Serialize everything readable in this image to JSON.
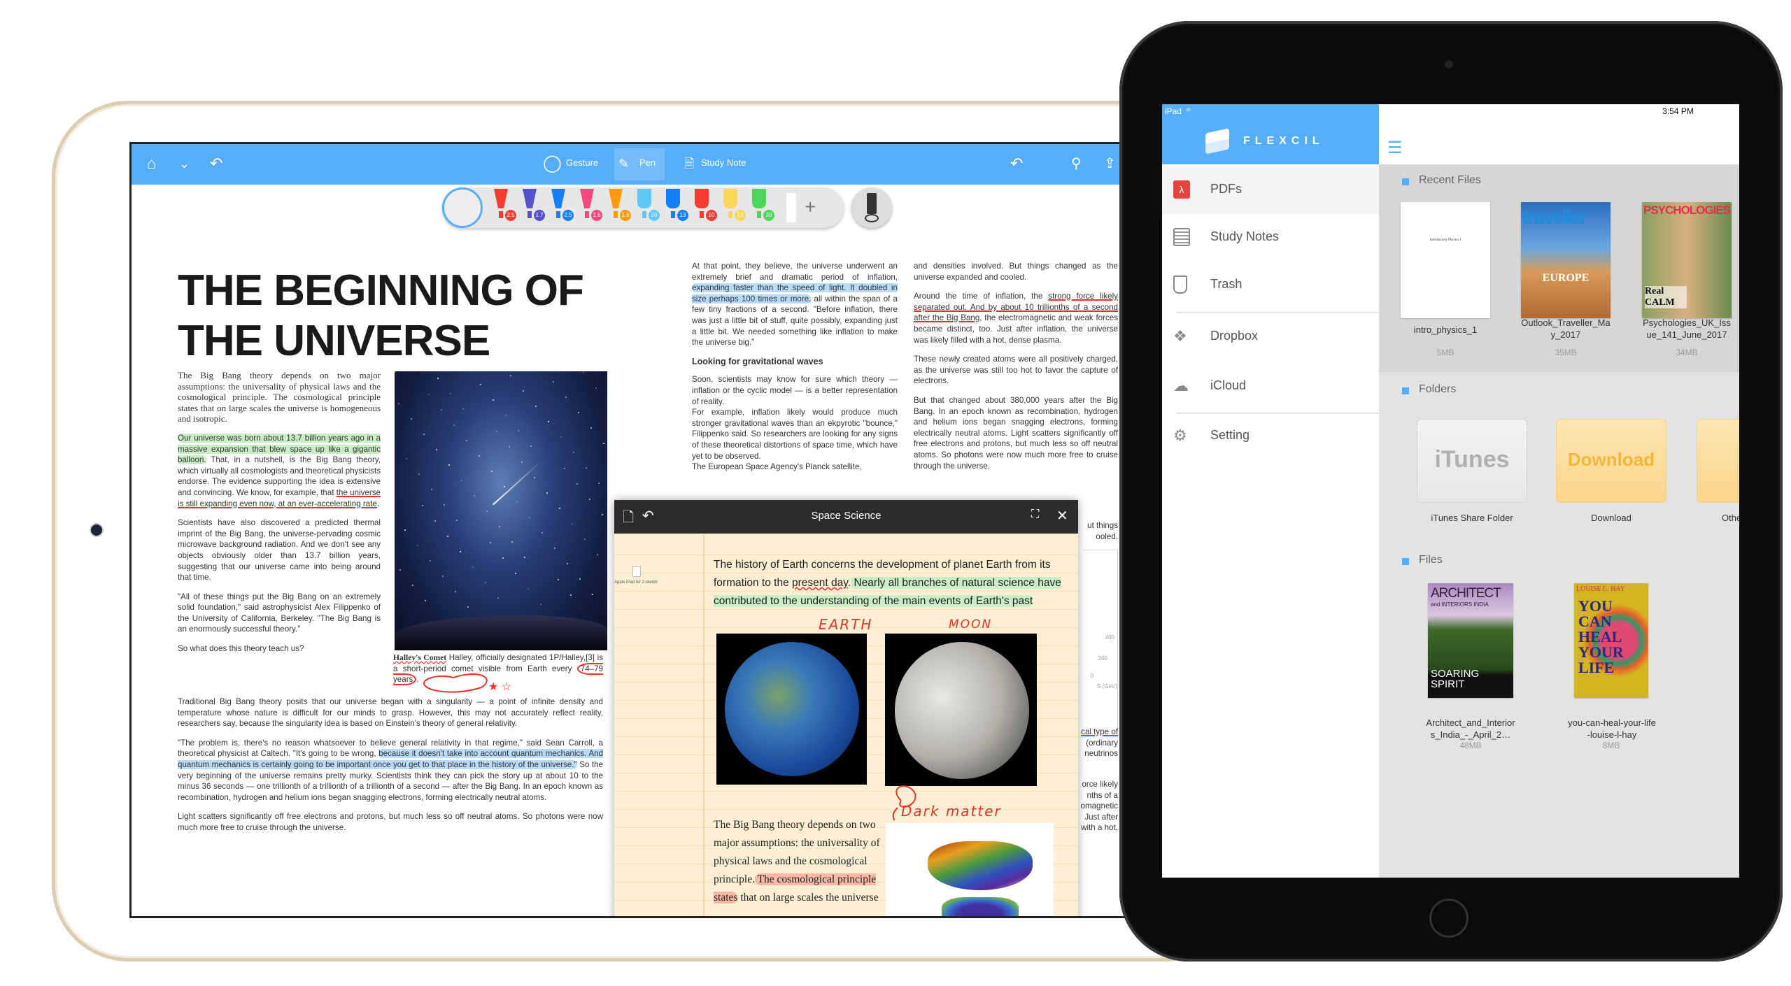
{
  "reader": {
    "toolbar": {
      "gesture": "Gesture",
      "pen": "Pen",
      "study_note": "Study Note",
      "accent": "#55aef7",
      "icons": [
        "home-icon",
        "chevron-down-icon",
        "undo-icon",
        "gesture-icon",
        "pen-icon",
        "study-note-icon",
        "redo-icon",
        "search-icon",
        "share-icon"
      ]
    },
    "pens": [
      {
        "color": "#f63b30",
        "size": "2.5",
        "type": "pen"
      },
      {
        "color": "#5552cc",
        "size": "1.7",
        "type": "pen"
      },
      {
        "color": "#1580f6",
        "size": "2.5",
        "type": "pen"
      },
      {
        "color": "#f5487c",
        "size": "1.6",
        "type": "pen"
      },
      {
        "color": "#fb9a10",
        "size": "1.6",
        "type": "pen"
      },
      {
        "color": "#5ec8f6",
        "size": "20",
        "type": "highlighter"
      },
      {
        "color": "#1580f6",
        "size": "13",
        "type": "highlighter"
      },
      {
        "color": "#f63b30",
        "size": "10",
        "type": "highlighter"
      },
      {
        "color": "#fbd75a",
        "size": "13",
        "type": "highlighter"
      },
      {
        "color": "#4cd65c",
        "size": "20",
        "type": "highlighter"
      }
    ],
    "add_pen": "+",
    "title_line1": "THE BEGINNING OF",
    "title_line2": "THE UNIVERSE",
    "col_left": [
      [
        {
          "t": "The Big Bang theory depends on two major assumptions: the universality of physical laws and the cosmological principle. The cosmo­logical principle states that on large scales the universe is homogeneous and isotropic.",
          "s": "plain"
        }
      ],
      [
        {
          "t": "Our universe was born about 13.7 billion years ago in a massive expansion that blew space up like a gigantic balloon.",
          "s": "green"
        },
        {
          "t": " That, in a nutshell, is the Big Bang theory, which virtually all cosmologists and theoretical physicists endorse. The evidence supporting the idea is extensive and convincing. We know, for example, that ",
          "s": "plain"
        },
        {
          "t": "the universe is still expanding even now, at an ever-accelerating rate",
          "s": "red"
        },
        {
          "t": ".",
          "s": "plain"
        }
      ],
      [
        {
          "t": "Scientists have also discovered a predicted thermal imprint of the Big Bang, the universe-pervading cosmic microwave background radiation. And we don't see any objects obviously older than 13.7 billion years, suggesting that our universe came into being around that time.",
          "s": "plain"
        }
      ],
      [
        {
          "t": "\"All of these things put the Big Bang on an extremely solid foundation,\" said astrophysicist Alex Filippenko of the University of California, Berkeley. \"The Big Bang is an enormously suc­cessful theory.\"",
          "s": "plain"
        }
      ],
      [
        {
          "t": "So what does this theory teach us?",
          "s": "plain"
        }
      ]
    ],
    "caption": [
      {
        "t": "Halley's Comet",
        "s": "wavy"
      },
      {
        "t": " Halley, officially designated 1P/Halley,[3] is a short-period comet visible from Earth every ",
        "s": "plain"
      },
      {
        "t": "74–79 years",
        "s": "circle"
      },
      {
        "t": ".",
        "s": "plain"
      }
    ],
    "full_width": [
      [
        {
          "t": "Traditional Big Bang theory posits that our universe began with a singularity — a point of infinite density and temperature whose nature is difficult for our minds to grasp. However, this may not accurately reflect reality, researchers say, because the singularity idea is based on Einstein's theory of general relativity.",
          "s": "plain"
        }
      ],
      [
        {
          "t": "\"The problem is, there's no reason whatsoever to believe general relativity in that regime,\" said Sean Carroll, a theoretical physicist at Caltech. \"It's going to be wrong, ",
          "s": "plain"
        },
        {
          "t": "because it doesn't take into account quantum mechanics. And quantum mechanics is certainly going to be important once you get to that place in the history of the universe.\"",
          "s": "blue"
        },
        {
          "t": " So the very beginning of the universe remains pretty murky. Scientists think they can pick the story up at about 10 to the minus 36 seconds — one trillionth of a trillionth of a trillionth of a second — after the Big Bang. In an epoch known as recombination, hydrogen and helium ions began snagging electrons, forming electrically neutral atoms.",
          "s": "plain"
        }
      ],
      [
        {
          "t": "Light scatters significantly off free electrons and protons, but much less so off neutral atoms. So photons were now much more free to cruise through the universe.",
          "s": "plain"
        }
      ]
    ],
    "col_mid": [
      [
        {
          "t": "At that point, they believe, the universe underwent an extremely brief and dramatic period of inflation, ",
          "s": "plain"
        },
        {
          "t": "expanding faster than the speed of light. It doubled in size perhaps 100 times or more,",
          "s": "blue"
        },
        {
          "t": " all within the span of a few tiny fractions of a second. \"Before inflation, there was just a little bit of stuff, quite possibly, expanding just a little bit. We needed something like inflation to make the universe big.\"",
          "s": "plain"
        }
      ]
    ],
    "col_mid_heading": "Looking for gravitational waves",
    "col_mid_2": [
      [
        {
          "t": "Soon, scientists may know for sure which theory — inflation or the cyclic model — is a better representation of reality.",
          "s": "plain"
        }
      ],
      [
        {
          "t": "For example, inflation likely would produce much stronger gravitational waves than an ekpyrotic \"bounce,\" Filippenko said. So researchers are looking for any signs of these theoretical distortions of space time, which have yet to be observed.",
          "s": "plain"
        }
      ],
      [
        {
          "t": "The European Space Agency's Planck satellite,",
          "s": "plain"
        }
      ]
    ],
    "col_right": [
      [
        {
          "t": "and densities involved. But things changed as the universe expanded and cooled.",
          "s": "plain"
        }
      ],
      [
        {
          "t": "Around the time of inflation, the ",
          "s": "plain"
        },
        {
          "t": "strong force likely separated out. And by about 10 trillionths of a second after the Big Bang",
          "s": "red"
        },
        {
          "t": ", the electromagnetic and weak forces became distinct, too. Just after inflation, the universe was likely filled with a hot, dense plasma.",
          "s": "plain"
        }
      ],
      [
        {
          "t": "These newly created atoms were all positively charged, as the universe was still too hot to favor the capture of electrons.",
          "s": "plain"
        }
      ],
      [
        {
          "t": "But that changed about 380,000 years after the Big Bang. In an epoch known as recombination, hydro­gen and helium ions began snagging electrons, forming electrically neutral atoms. Light scatters significantly off free electrons and protons, but much less so off neutral atoms. So photons were now much more free to cruise through the universe.",
          "s": "plain"
        }
      ]
    ],
    "right_peek": {
      "a": [
        "ut things",
        "ooled."
      ],
      "b": [
        "cal type of",
        "(ordinary",
        "neutrinos"
      ],
      "c": [
        "orce likely",
        "nths of a",
        "omagnetic",
        "Just after",
        "with a hot,"
      ],
      "chart_ticks": [
        "400",
        "200",
        "0",
        "S (GeV)"
      ]
    }
  },
  "popup": {
    "title": "Space Science",
    "file_name": "Apple iPad Air 2.sketch",
    "intro": [
      {
        "t": "The history of Earth concerns the development of planet Earth from its formation to the ",
        "s": "plain"
      },
      {
        "t": "present day",
        "s": "wavyline"
      },
      {
        "t": ".",
        "s": "plain"
      },
      {
        "t": " Nearly all branches of natural science have contributed to the understanding of the main events of Earth's past",
        "s": "green"
      }
    ],
    "label_earth": "EARTH",
    "label_moon": "MOON",
    "label_dark_matter": "Dark matter",
    "serif_text": [
      {
        "t": "The Big Bang theory depends on two major assumptions: the universality of physical laws and the cosmological principle.",
        "s": "plain"
      },
      {
        "t": " The cosmological principle states",
        "s": "salmon"
      },
      {
        "t": " that on large scales the universe",
        "s": "plain"
      }
    ]
  },
  "flexcil": {
    "status": {
      "device": "iPad",
      "time": "3:54 PM"
    },
    "brand": "FLEXCIL",
    "accent": "#55aef7",
    "sidebar": [
      {
        "label": "PDFs",
        "icon": "pdf-icon",
        "selected": true
      },
      {
        "label": "Study Notes",
        "icon": "notebook-icon"
      },
      {
        "label": "Trash",
        "icon": "trash-icon"
      },
      {
        "label": "Dropbox",
        "icon": "dropbox-icon"
      },
      {
        "label": "iCloud",
        "icon": "cloud-icon"
      },
      {
        "label": "Setting",
        "icon": "gear-icon"
      }
    ],
    "recent_label": "Recent Files",
    "recent": [
      {
        "name": "intro_physics_1",
        "size": "5MB",
        "cover": [
          "Introductory Physics I"
        ]
      },
      {
        "name": "Outlook_Traveller_May_2017",
        "size": "35MB",
        "cover": [
          "traveller",
          "EUROPE"
        ]
      },
      {
        "name": "Psychologies_UK_Issue_141_June_2017",
        "size": "34MB",
        "cover": [
          "PSYCHOLOGIES",
          "Real CALM"
        ]
      }
    ],
    "folders_label": "Folders",
    "folders": [
      {
        "name": "iTunes Share Folder",
        "badge": "iTunes",
        "color": "#ececec"
      },
      {
        "name": "Download",
        "badge": "Download",
        "color": "#fbdc9a"
      },
      {
        "name": "Other",
        "badge": "",
        "color": "#fbdc9a"
      }
    ],
    "files_label": "Files",
    "files": [
      {
        "name": "Architect_and_Interiors_India_-_April_2…",
        "size": "48MB",
        "cover": [
          "ARCHITECT",
          "and INTERIORS INDIA",
          "SOARING SPIRIT"
        ]
      },
      {
        "name": "you-can-heal-your-life-louise-l-hay",
        "size": "8MB",
        "cover": [
          "LOUISE L. HAY",
          "YOU CAN HEAL YOUR LIFE"
        ]
      }
    ]
  }
}
